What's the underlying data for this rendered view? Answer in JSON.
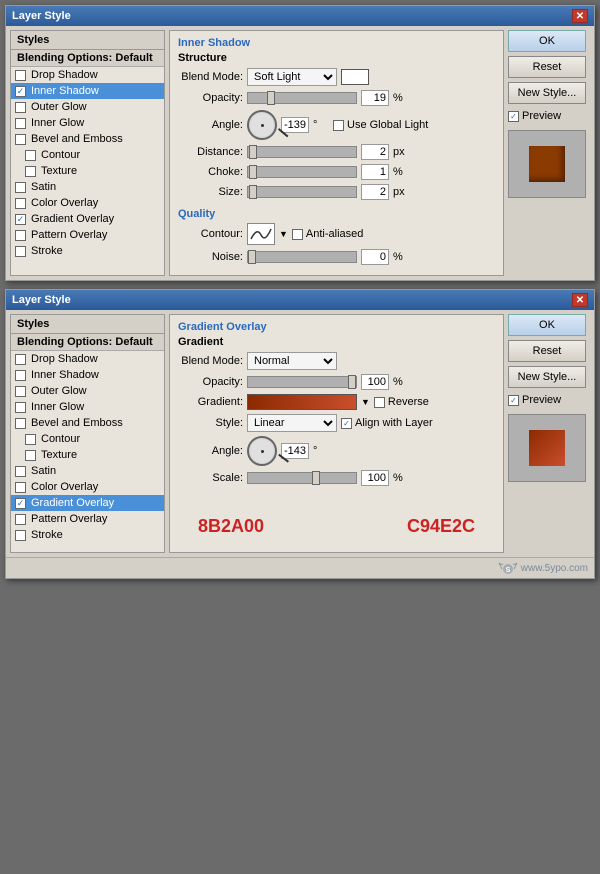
{
  "dialog1": {
    "title": "Layer Style",
    "left_panel": {
      "header": "Styles",
      "items": [
        {
          "id": "blending",
          "label": "Blending Options: Default",
          "type": "header",
          "checked": false
        },
        {
          "id": "drop-shadow",
          "label": "Drop Shadow",
          "type": "item",
          "checked": false
        },
        {
          "id": "inner-shadow",
          "label": "Inner Shadow",
          "type": "item",
          "checked": true,
          "active": true
        },
        {
          "id": "outer-glow",
          "label": "Outer Glow",
          "type": "item",
          "checked": false
        },
        {
          "id": "inner-glow",
          "label": "Inner Glow",
          "type": "item",
          "checked": false
        },
        {
          "id": "bevel-emboss",
          "label": "Bevel and Emboss",
          "type": "item",
          "checked": false
        },
        {
          "id": "contour",
          "label": "Contour",
          "type": "subitem",
          "checked": false
        },
        {
          "id": "texture",
          "label": "Texture",
          "type": "subitem",
          "checked": false
        },
        {
          "id": "satin",
          "label": "Satin",
          "type": "item",
          "checked": false
        },
        {
          "id": "color-overlay",
          "label": "Color Overlay",
          "type": "item",
          "checked": false
        },
        {
          "id": "gradient-overlay",
          "label": "Gradient Overlay",
          "type": "item",
          "checked": true
        },
        {
          "id": "pattern-overlay",
          "label": "Pattern Overlay",
          "type": "item",
          "checked": false
        },
        {
          "id": "stroke",
          "label": "Stroke",
          "type": "item",
          "checked": false
        }
      ]
    },
    "main": {
      "section_title": "Inner Shadow",
      "subsection": "Structure",
      "blend_mode_label": "Blend Mode:",
      "blend_mode_value": "Soft Light",
      "opacity_label": "Opacity:",
      "opacity_value": "19",
      "opacity_unit": "%",
      "angle_label": "Angle:",
      "angle_value": "-139",
      "angle_unit": "°",
      "use_global_light": "Use Global Light",
      "distance_label": "Distance:",
      "distance_value": "2",
      "distance_unit": "px",
      "choke_label": "Choke:",
      "choke_value": "1",
      "choke_unit": "%",
      "size_label": "Size:",
      "size_value": "2",
      "size_unit": "px",
      "quality_title": "Quality",
      "contour_label": "Contour:",
      "anti_alias": "Anti-aliased",
      "noise_label": "Noise:",
      "noise_value": "0",
      "noise_unit": "%"
    },
    "buttons": {
      "ok": "OK",
      "reset": "Reset",
      "new_style": "New Style...",
      "preview": "Preview"
    }
  },
  "dialog2": {
    "title": "Layer Style",
    "left_panel": {
      "header": "Styles",
      "items": [
        {
          "id": "blending",
          "label": "Blending Options: Default",
          "type": "header",
          "checked": false
        },
        {
          "id": "drop-shadow",
          "label": "Drop Shadow",
          "type": "item",
          "checked": false
        },
        {
          "id": "inner-shadow",
          "label": "Inner Shadow",
          "type": "item",
          "checked": false
        },
        {
          "id": "outer-glow",
          "label": "Outer Glow",
          "type": "item",
          "checked": false
        },
        {
          "id": "inner-glow",
          "label": "Inner Glow",
          "type": "item",
          "checked": false
        },
        {
          "id": "bevel-emboss",
          "label": "Bevel and Emboss",
          "type": "item",
          "checked": false
        },
        {
          "id": "contour",
          "label": "Contour",
          "type": "subitem",
          "checked": false
        },
        {
          "id": "texture",
          "label": "Texture",
          "type": "subitem",
          "checked": false
        },
        {
          "id": "satin",
          "label": "Satin",
          "type": "item",
          "checked": false
        },
        {
          "id": "color-overlay",
          "label": "Color Overlay",
          "type": "item",
          "checked": false
        },
        {
          "id": "gradient-overlay",
          "label": "Gradient Overlay",
          "type": "item",
          "checked": true,
          "active": true
        },
        {
          "id": "pattern-overlay",
          "label": "Pattern Overlay",
          "type": "item",
          "checked": false
        },
        {
          "id": "stroke",
          "label": "Stroke",
          "type": "item",
          "checked": false
        }
      ]
    },
    "main": {
      "section_title": "Gradient Overlay",
      "subsection": "Gradient",
      "blend_mode_label": "Blend Mode:",
      "blend_mode_value": "Normal",
      "opacity_label": "Opacity:",
      "opacity_value": "100",
      "opacity_unit": "%",
      "gradient_label": "Gradient:",
      "reverse": "Reverse",
      "style_label": "Style:",
      "style_value": "Linear",
      "align_layer": "Align with Layer",
      "angle_label": "Angle:",
      "angle_value": "-143",
      "angle_unit": "°",
      "scale_label": "Scale:",
      "scale_value": "100",
      "scale_unit": "%",
      "annotation_left": "8B2A00",
      "annotation_right": "C94E2C"
    },
    "buttons": {
      "ok": "OK",
      "reset": "Reset",
      "new_style": "New Style...",
      "preview": "Preview"
    }
  },
  "watermark": "www.5ypo.com"
}
